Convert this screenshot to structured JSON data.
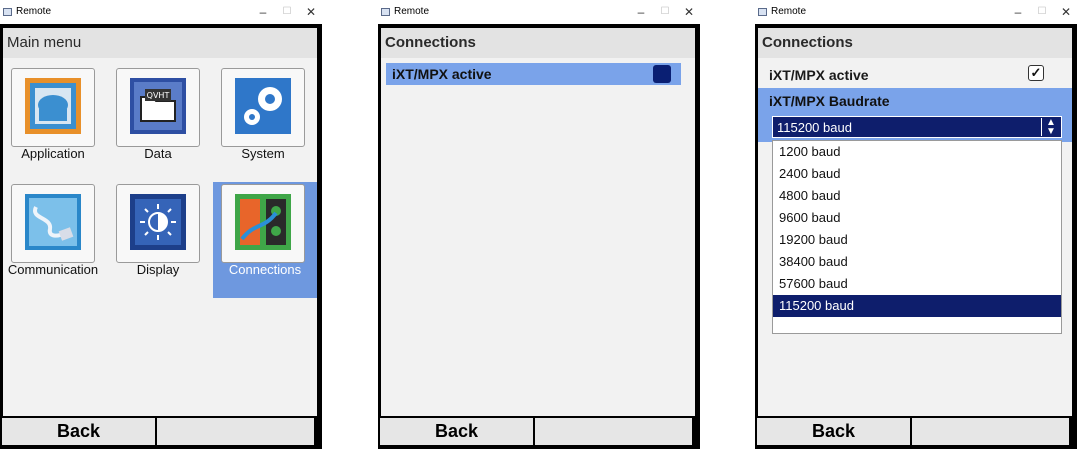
{
  "window_title": "Remote",
  "panel1": {
    "header": "Main menu",
    "tiles": [
      {
        "label": "Application"
      },
      {
        "label": "Data"
      },
      {
        "label": "System"
      },
      {
        "label": "Communication"
      },
      {
        "label": "Display"
      },
      {
        "label": "Connections",
        "selected": true
      }
    ],
    "back_label": "Back"
  },
  "panel2": {
    "header": "Connections",
    "rows": [
      {
        "label": "iXT/MPX active",
        "selected": true
      }
    ],
    "back_label": "Back"
  },
  "panel3": {
    "header": "Connections",
    "active_label": "iXT/MPX active",
    "active_checked": true,
    "baud_label": "iXT/MPX Baudrate",
    "selected_value": "115200 baud",
    "options": [
      "1200 baud",
      "2400 baud",
      "4800 baud",
      "9600 baud",
      "19200 baud",
      "38400 baud",
      "57600 baud",
      "115200 baud"
    ],
    "selected_option_index": 7,
    "back_label": "Back"
  },
  "colors": {
    "selection_blue": "#7aa3ea",
    "dark_navy": "#0e1e6c",
    "tile_selected": "#6e98df"
  },
  "icons": [
    "application-icon",
    "data-folder-icon",
    "system-gears-icon",
    "communication-icon",
    "display-brightness-icon",
    "connections-icon"
  ]
}
